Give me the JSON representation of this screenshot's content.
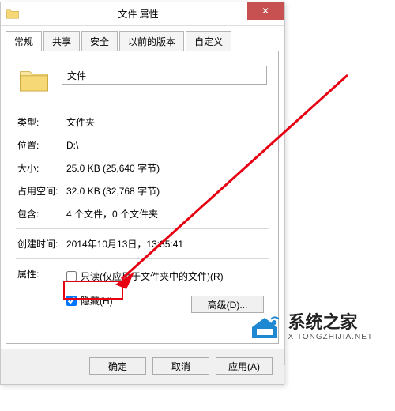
{
  "window": {
    "title": "文件 属性",
    "close_glyph": "✕"
  },
  "tabs": [
    "常规",
    "共享",
    "安全",
    "以前的版本",
    "自定义"
  ],
  "name_value": "文件",
  "fields": {
    "type": {
      "label": "类型:",
      "value": "文件夹"
    },
    "location": {
      "label": "位置:",
      "value": "D:\\"
    },
    "size": {
      "label": "大小:",
      "value": "25.0 KB (25,640 字节)"
    },
    "size_on_disk": {
      "label": "占用空间:",
      "value": "32.0 KB (32,768 字节)"
    },
    "contains": {
      "label": "包含:",
      "value": "4 个文件，0 个文件夹"
    },
    "created": {
      "label": "创建时间:",
      "value": "2014年10月13日，13:35:41"
    },
    "attributes_label": "属性:"
  },
  "checkboxes": {
    "readonly": {
      "label": "只读(仅应用于文件夹中的文件)(R)",
      "checked": false
    },
    "hidden": {
      "label": "隐藏(H)",
      "checked": true
    }
  },
  "buttons": {
    "advanced": "高级(D)...",
    "ok": "确定",
    "cancel": "取消",
    "apply": "应用(A)"
  },
  "watermark": {
    "line1": "系统之家",
    "line2": "XITONGZHIJIA.NET"
  }
}
